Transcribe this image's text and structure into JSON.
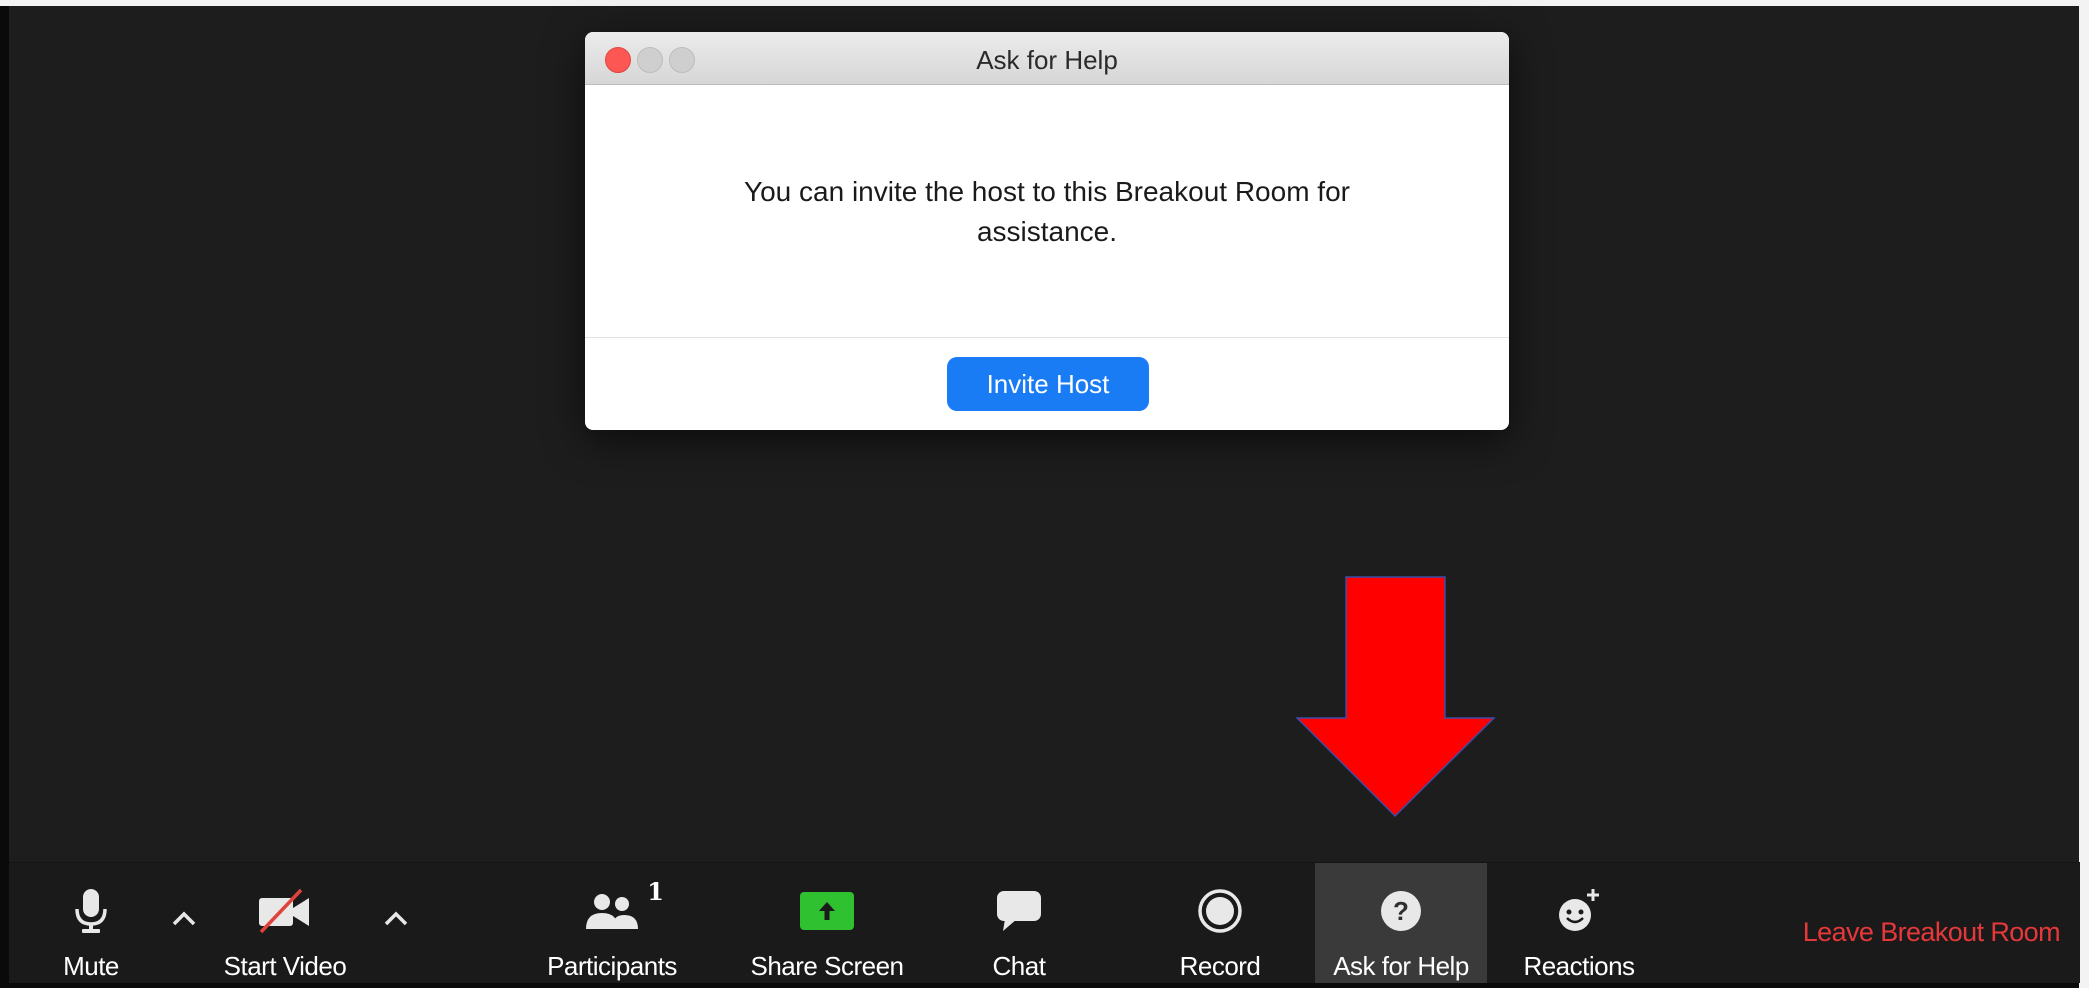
{
  "dialog": {
    "title": "Ask for Help",
    "message": "You can invite the host to this Breakout Room for assistance.",
    "invite_button": "Invite Host"
  },
  "toolbar": {
    "mute": "Mute",
    "start_video": "Start Video",
    "participants": "Participants",
    "participants_count": "1",
    "share_screen": "Share Screen",
    "chat": "Chat",
    "record": "Record",
    "ask_for_help": "Ask for Help",
    "reactions": "Reactions",
    "leave": "Leave Breakout Room"
  },
  "colors": {
    "invite_button": "#1a7cf5",
    "share_screen": "#2fc12f",
    "leave_text": "#e6383a",
    "arrow": "#ff0000"
  },
  "icons": [
    "microphone-icon",
    "video-off-icon",
    "participants-icon",
    "share-screen-icon",
    "chat-icon",
    "record-icon",
    "help-icon",
    "reactions-icon"
  ]
}
